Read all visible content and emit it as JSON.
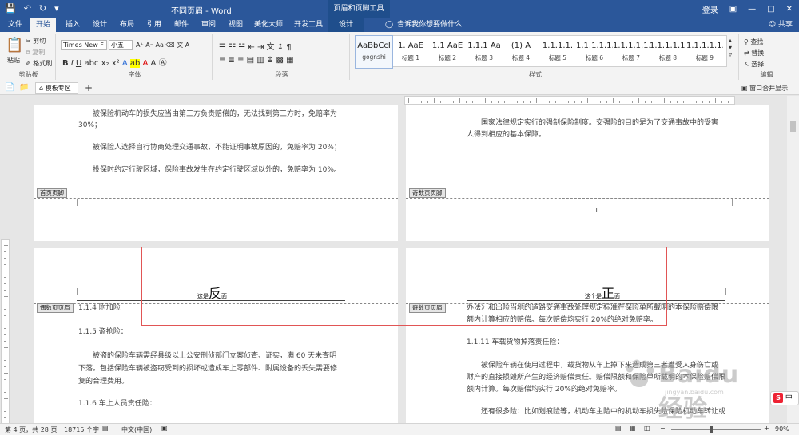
{
  "titlebar": {
    "doc_title": "不同页眉 - Word",
    "context_title": "页眉和页脚工具",
    "login": "登录"
  },
  "tabs": {
    "file": "文件",
    "home": "开始",
    "insert": "插入",
    "design": "设计",
    "layout": "布局",
    "references": "引用",
    "mailings": "邮件",
    "review": "审阅",
    "view": "视图",
    "beautify": "美化大师",
    "developer": "开发工具",
    "hf_design": "设计",
    "tell_me": "告诉我你想要做什么",
    "share": "共享"
  },
  "ribbon": {
    "paste": "粘贴",
    "cut": "剪切",
    "copy": "复制",
    "format_painter": "格式刷",
    "clipboard": "剪贴板",
    "font_name": "Times New F",
    "font_size": "小五",
    "font_group": "字体",
    "paragraph_group": "段落",
    "styles_group": "样式",
    "editing_group": "编辑",
    "find": "查找",
    "replace": "替换",
    "select": "选择",
    "styles": [
      {
        "preview": "AaBbCcI",
        "name": "gognshi"
      },
      {
        "preview": "1. AaE",
        "name": "标题 1"
      },
      {
        "preview": "1.1 AaE",
        "name": "标题 2"
      },
      {
        "preview": "1.1.1 Aa",
        "name": "标题 3"
      },
      {
        "preview": "(1) A",
        "name": "标题 4"
      },
      {
        "preview": "1.1.1.1.",
        "name": "标题 5"
      },
      {
        "preview": "1.1.1.1.1.",
        "name": "标题 6"
      },
      {
        "preview": "1.1.1.1.1.",
        "name": "标题 7"
      },
      {
        "preview": "1.1.1.1.1.",
        "name": "标题 8"
      },
      {
        "preview": "1.1.1.1.1.1.",
        "name": "标题 9"
      }
    ]
  },
  "doc_tabs": {
    "template_area": "模板专区",
    "merge_display": "窗口合并显示"
  },
  "pages": {
    "top_left": {
      "lines": [
        "被保险机动车的损失应当由第三方负责赔偿的，无法找到第三方时，免赔率为",
        "30%；",
        "被保险人选择自行协商处理交通事故，不能证明事故原因的，免赔率为 20%；",
        "投保时约定行驶区域，保险事故发生在约定行驶区域以外的，免赔率为 10%。"
      ],
      "footer_label": "首页页脚"
    },
    "top_right": {
      "lines": [
        "国家法律规定实行的强制保险制度。交强险的目的是为了交通事故中的受害",
        "人得到相应的基本保障。"
      ],
      "footer_label": "奇数页页脚",
      "page_number": "1"
    },
    "bottom_left": {
      "header_small": "这是",
      "header_big": "反",
      "header_suffix": "面",
      "header_label": "偶数页页眉",
      "lines": [
        "1.1.4   附加险",
        "1.1.5   盗抢险：",
        "被盗的保险车辆需经县级以上公安刑侦部门立案侦查、证实，满 60 天未查明",
        "下落。包括保险车辆被盗窃受到的损坏或造成车上零部件、附属设备的丢失需要修",
        "复的合理费用。",
        "1.1.6   车上人员责任险："
      ]
    },
    "bottom_right": {
      "header_small": "这个是",
      "header_big": "正",
      "header_suffix": "面",
      "header_label": "奇数页页眉",
      "lines": [
        "办法》和出险当地的道路交通事故处理规定标准在保险单所载明的本保险赔偿限",
        "额内计算相应的赔偿。每次赔偿均实行 20%的绝对免赔率。",
        "1.1.11 车载货物掉落责任险：",
        "被保险车辆在使用过程中，载货物从车上掉下来造成第三者遭受人身伤亡或",
        "财产的直接损毁所产生的经济赔偿责任。赔偿限额和保险单所载明的本保险赔偿限",
        "额内计算。每次赔偿均实行 20%的绝对免赔率。",
        "还有很多险：比如划痕险等，机动车主险中的机动车损失险保险机动车转让或"
      ]
    }
  },
  "watermark": {
    "text": "Baidu经验",
    "url": "jingyan.baidu.com"
  },
  "ime": {
    "label": "中"
  },
  "status": {
    "page": "第 4 页，共 28 页",
    "words": "18715 个字",
    "language": "中文(中国)",
    "zoom": "90%"
  },
  "colors": {
    "brand": "#2b579a",
    "annotation": "#e15555"
  }
}
